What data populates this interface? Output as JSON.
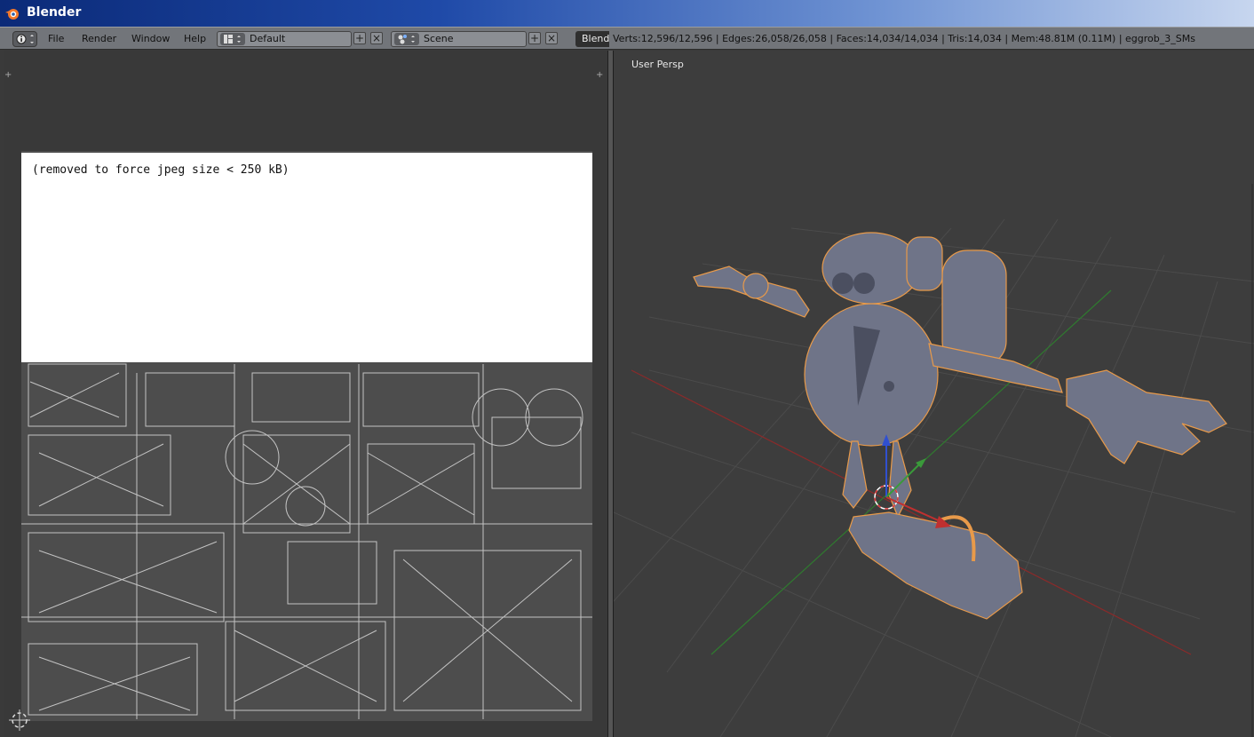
{
  "window": {
    "title": "Blender"
  },
  "header": {
    "menus": [
      "File",
      "Render",
      "Window",
      "Help"
    ],
    "layout": {
      "value": "Default"
    },
    "scene": {
      "value": "Scene"
    },
    "engine": "Blend",
    "stats": "Verts:12,596/12,596 | Edges:26,058/26,058 | Faces:14,034/14,034 | Tris:14,034 | Mem:48.81M (0.11M) | eggrob_3_SMs"
  },
  "uv_editor": {
    "notice": "(removed to force jpeg size < 250 kB)"
  },
  "viewport": {
    "label": "User Persp"
  },
  "colors": {
    "axis_x": "#b03030",
    "axis_y": "#3a9a3a",
    "axis_z": "#3050d0",
    "selection_outline": "#e89a4a",
    "model": "#6f7488"
  }
}
